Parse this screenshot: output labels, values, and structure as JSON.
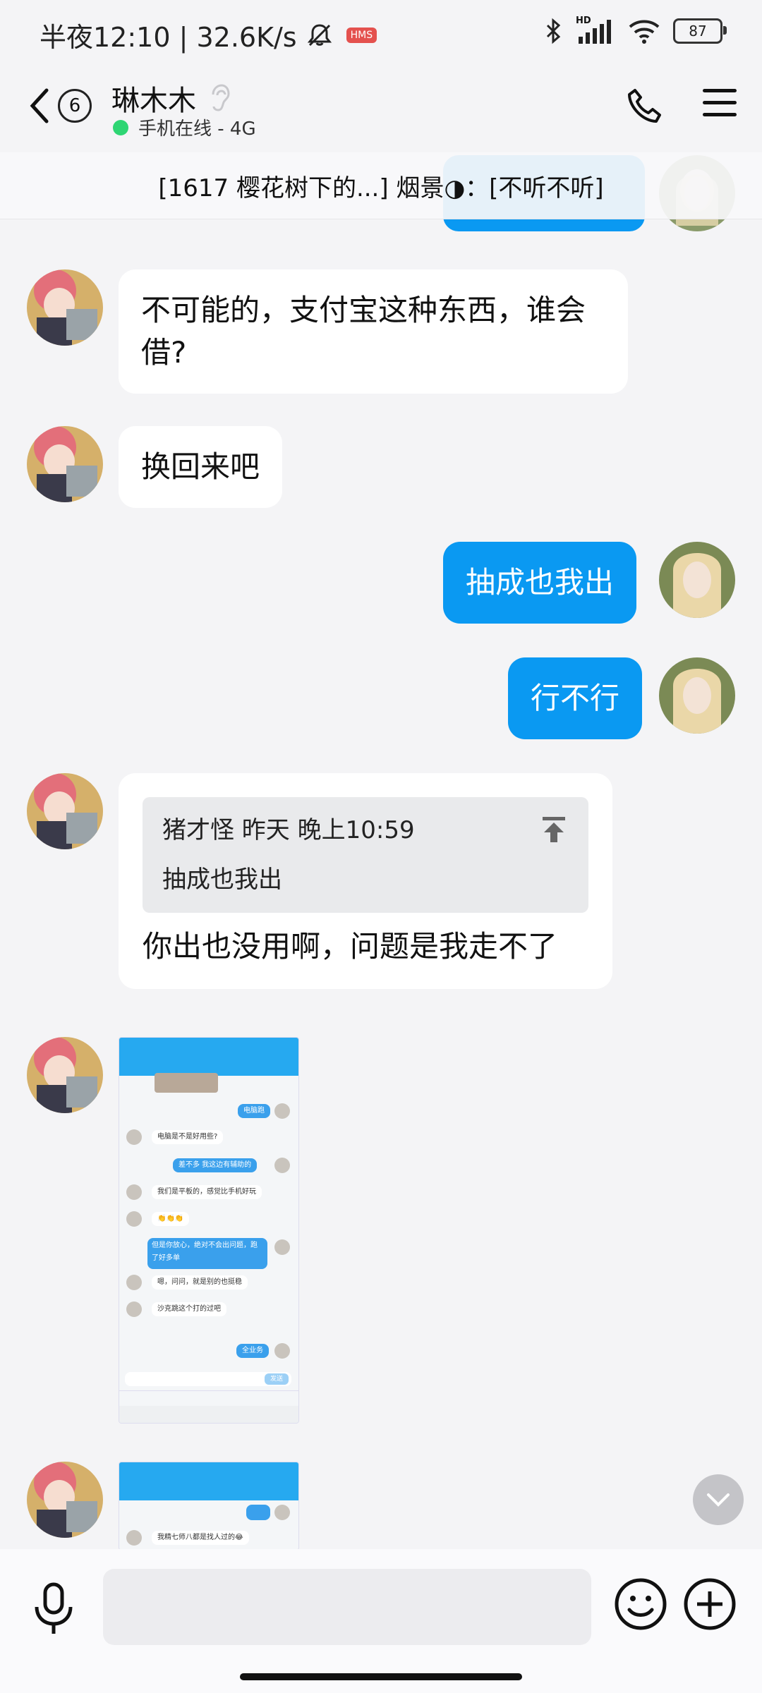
{
  "status_bar": {
    "time_speed": "半夜12:10 | 32.6K/s",
    "hms_badge": "HMS",
    "hd_label": "HD",
    "battery": "87"
  },
  "header": {
    "badge_count": "6",
    "contact_name": "琳木木",
    "presence": "手机在线 - 4G"
  },
  "pinned": {
    "text": "[1617 樱花树下的...] 烟景◑：[不听不听]"
  },
  "messages": [
    {
      "side": "in",
      "text": "不可能的，支付宝这种东西，谁会借?"
    },
    {
      "side": "in",
      "text": "换回来吧"
    },
    {
      "side": "out",
      "text": "抽成也我出"
    },
    {
      "side": "out",
      "text": "行不行"
    },
    {
      "side": "in",
      "quote_author": "猪才怪 昨天 晚上10:59",
      "quote_text": "抽成也我出",
      "text": "你出也没用啊，问题是我走不了"
    }
  ],
  "screenshot_1": {
    "rows": [
      {
        "side": "out",
        "text": "电脑跑"
      },
      {
        "side": "in",
        "text": "电脑是不是好用些?"
      },
      {
        "side": "out",
        "text": "差不多 我这边有辅助的"
      },
      {
        "side": "in",
        "text": "我们是平板的，感觉比手机好玩"
      },
      {
        "side": "in",
        "text": "👏👏👏"
      },
      {
        "side": "out",
        "text": "但是你放心，绝对不会出问题，跑了好多单"
      },
      {
        "side": "in",
        "text": "嗯，问问，就是别的也挺稳"
      },
      {
        "side": "in",
        "text": "沙克跳这个打的过吧"
      },
      {
        "side": "out",
        "text": "全业务"
      }
    ],
    "send_label": "发送"
  },
  "screenshot_2": {
    "rows": [
      {
        "side": "in",
        "text": "我精七师八都是找人过的😂"
      }
    ]
  },
  "input": {
    "placeholder": ""
  }
}
